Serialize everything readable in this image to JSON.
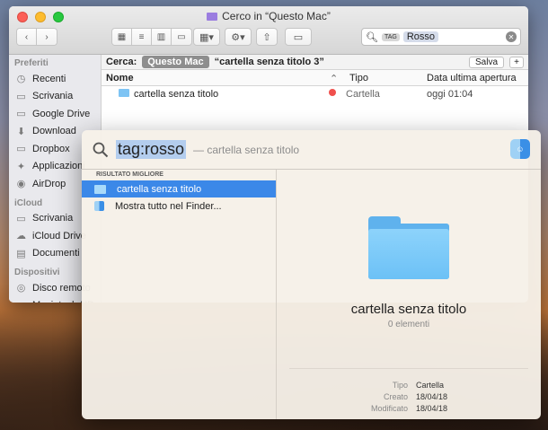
{
  "finder": {
    "title": "Cerco in “Questo Mac”",
    "search": {
      "tag_label": "TAG",
      "token": "Rosso"
    },
    "sidebar": {
      "sections": [
        {
          "header": "Preferiti",
          "items": [
            {
              "label": "Recenti",
              "icon": "clock-icon"
            },
            {
              "label": "Scrivania",
              "icon": "desktop-icon"
            },
            {
              "label": "Google Drive",
              "icon": "folder-icon"
            },
            {
              "label": "Download",
              "icon": "download-icon"
            },
            {
              "label": "Dropbox",
              "icon": "folder-icon"
            },
            {
              "label": "Applicazioni",
              "icon": "apps-icon"
            },
            {
              "label": "AirDrop",
              "icon": "airdrop-icon"
            }
          ]
        },
        {
          "header": "iCloud",
          "items": [
            {
              "label": "Scrivania",
              "icon": "folder-icon"
            },
            {
              "label": "iCloud Drive",
              "icon": "cloud-icon"
            },
            {
              "label": "Documenti",
              "icon": "document-icon"
            }
          ]
        },
        {
          "header": "Dispositivi",
          "items": [
            {
              "label": "Disco remoto",
              "icon": "disc-icon"
            },
            {
              "label": "Macintosh HD",
              "icon": "hd-icon"
            }
          ]
        }
      ]
    },
    "scope": {
      "label": "Cerca:",
      "active": "Questo Mac",
      "other": "“cartella senza titolo 3”",
      "save": "Salva",
      "add": "+"
    },
    "columns": {
      "name": "Nome",
      "type": "Tipo",
      "date": "Data ultima apertura"
    },
    "rows": [
      {
        "name": "cartella senza titolo",
        "type": "Cartella",
        "date": "oggi 01:04",
        "tag_color": "#f0504d"
      }
    ]
  },
  "spotlight": {
    "query": "tag:rosso",
    "hint": "— cartella senza titolo",
    "section_header": "RISULTATO MIGLIORE",
    "results": [
      {
        "label": "cartella senza titolo",
        "icon": "folder-icon",
        "selected": true
      },
      {
        "label": "Mostra tutto nel Finder...",
        "icon": "finder-icon",
        "selected": false
      }
    ],
    "preview": {
      "title": "cartella senza titolo",
      "subtitle": "0 elementi",
      "meta": [
        {
          "key": "Tipo",
          "value": "Cartella"
        },
        {
          "key": "Creato",
          "value": "18/04/18"
        },
        {
          "key": "Modificato",
          "value": "18/04/18"
        }
      ]
    }
  },
  "colors": {
    "selection": "#3b88e8",
    "tag_red": "#f0504d",
    "folder_blue": "#7ec4f4"
  }
}
